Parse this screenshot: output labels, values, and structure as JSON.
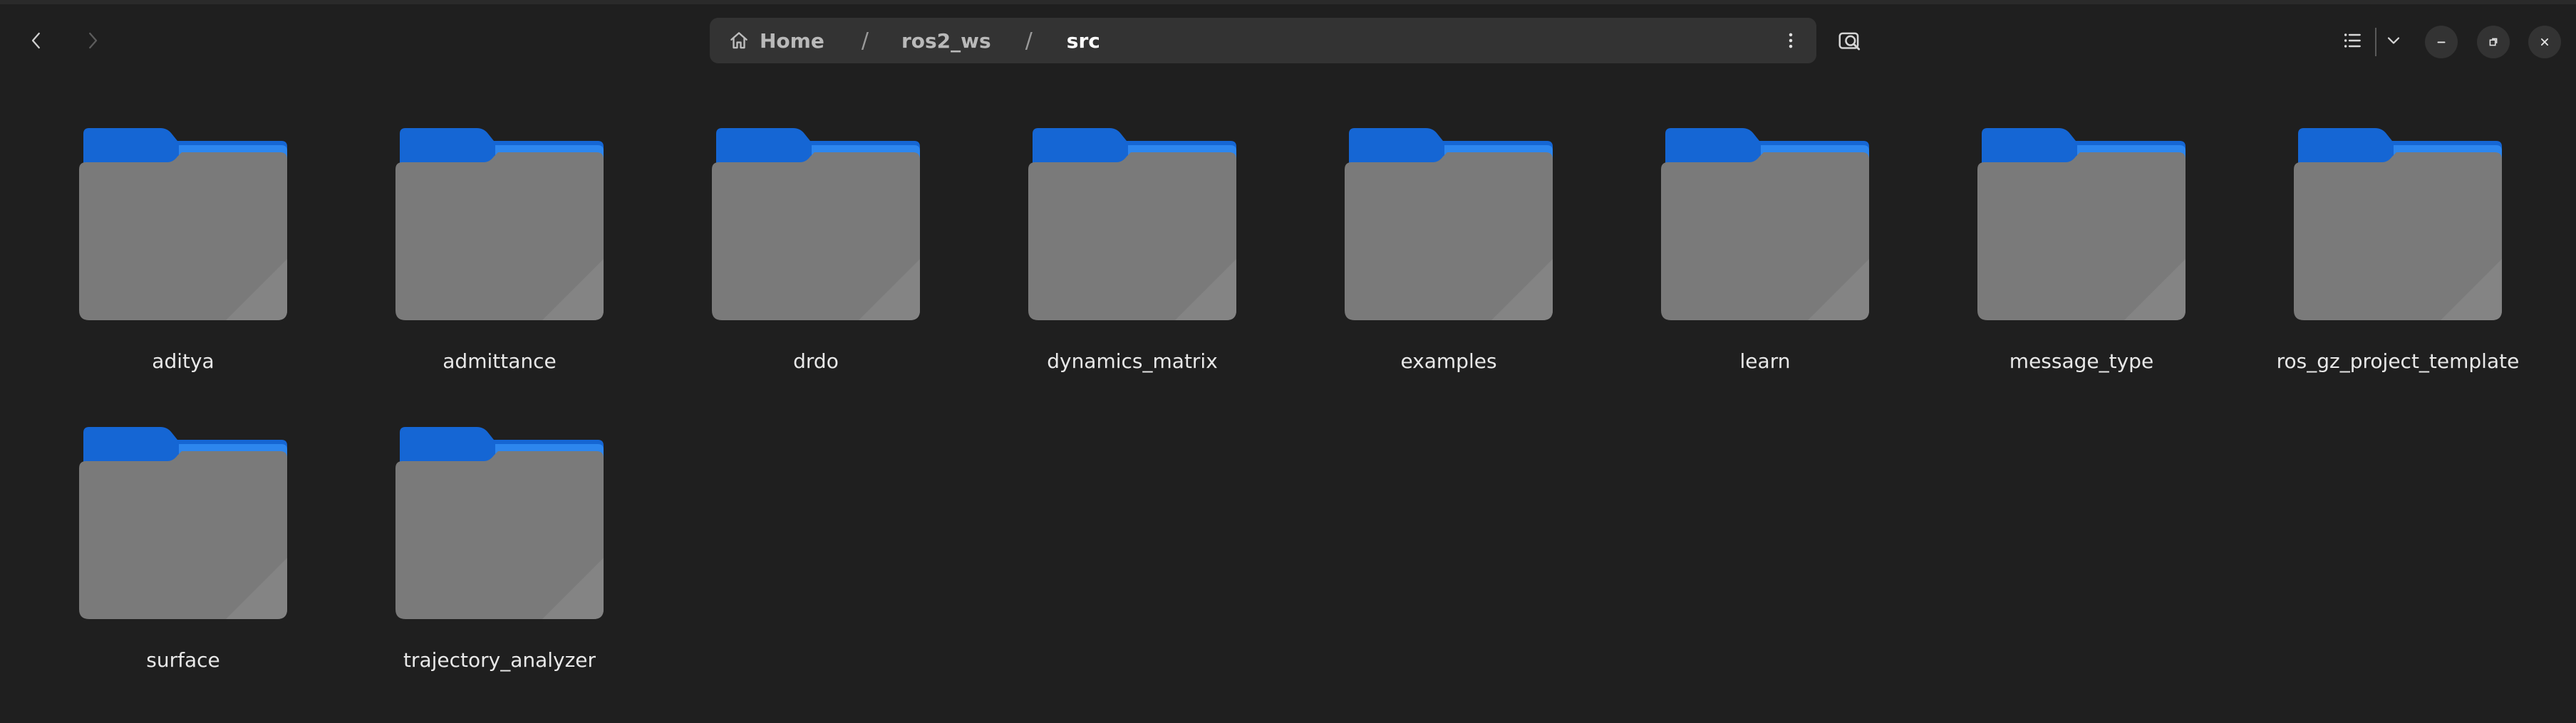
{
  "window": {
    "title": "src"
  },
  "colors": {
    "background": "#1f1f1f",
    "pathbar": "#333333",
    "folder_tab": "#1a6fd8",
    "folder_body": "#7a7a7a"
  },
  "nav": {
    "back_icon": "chevron-left-icon",
    "forward_icon": "chevron-right-icon"
  },
  "pathbar": {
    "home_label": "Home",
    "separator": "/",
    "crumbs": [
      "ros2_ws",
      "src"
    ],
    "menu_icon": "vertical-dots-icon"
  },
  "toolbar": {
    "search_icon": "search-icon",
    "view_icon": "list-view-icon",
    "view_dropdown_icon": "chevron-down-icon"
  },
  "window_controls": {
    "minimize_icon": "minimize-icon",
    "maximize_icon": "maximize-icon",
    "close_icon": "close-icon"
  },
  "files": [
    {
      "name": "aditya"
    },
    {
      "name": "admittance"
    },
    {
      "name": "drdo"
    },
    {
      "name": "dynamics_matrix"
    },
    {
      "name": "examples"
    },
    {
      "name": "learn"
    },
    {
      "name": "message_type"
    },
    {
      "name": "ros_gz_project_template"
    },
    {
      "name": "surface"
    },
    {
      "name": "trajectory_analyzer"
    }
  ]
}
